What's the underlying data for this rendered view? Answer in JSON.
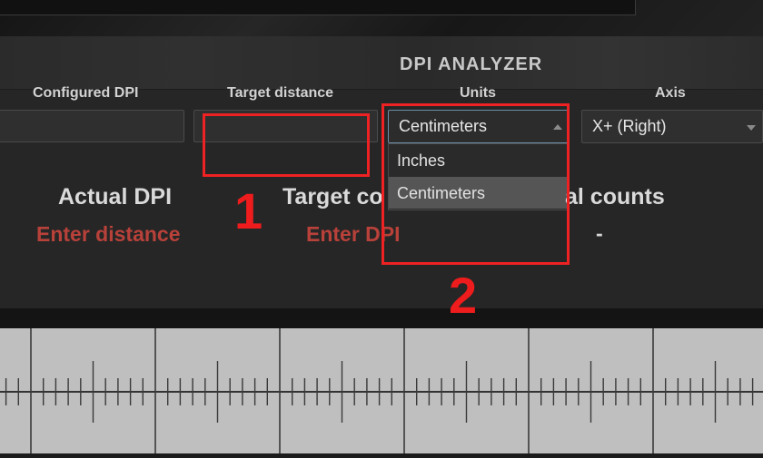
{
  "app": {
    "title": "DPI ANALYZER"
  },
  "inputs": {
    "configured_dpi": {
      "label": "Configured DPI",
      "value": ""
    },
    "target_distance": {
      "label": "Target distance",
      "value": ""
    },
    "units": {
      "label": "Units",
      "selected": "Centimeters",
      "options": [
        "Inches",
        "Centimeters"
      ],
      "highlighted_option": "Centimeters",
      "open": true
    },
    "axis": {
      "label": "Axis",
      "selected": "X+ (Right)"
    }
  },
  "results": {
    "actual_dpi": {
      "label": "Actual DPI",
      "value": "Enter distance"
    },
    "target_counts": {
      "label": "Target co",
      "value": "Enter DPI"
    },
    "actual_counts": {
      "label": "al counts",
      "value": "-"
    }
  },
  "annotations": [
    {
      "number": "1",
      "target": "target-distance-input"
    },
    {
      "number": "2",
      "target": "units-select"
    }
  ],
  "colors": {
    "accent_red": "#ee2222",
    "result_red": "#b8413a",
    "panel_bg": "#262626",
    "ruler_bg": "#bfbfbf"
  }
}
